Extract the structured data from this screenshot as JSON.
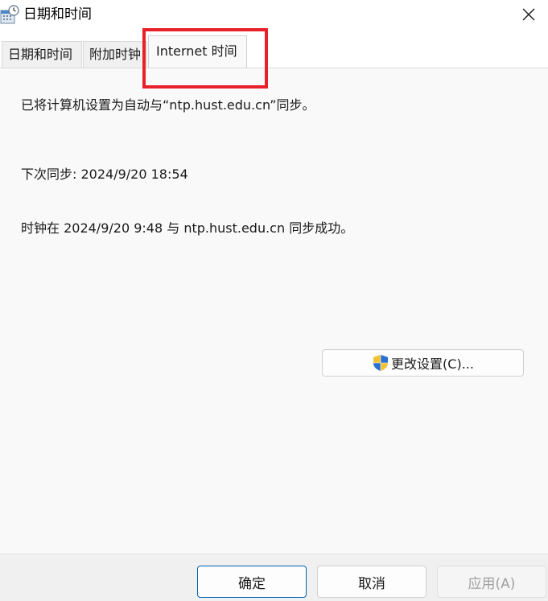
{
  "window": {
    "title": "日期和时间",
    "icon": "calendar-clock-icon",
    "close_icon": "close-icon"
  },
  "tabs": [
    {
      "label": "日期和时间",
      "selected": false
    },
    {
      "label": "附加时钟",
      "selected": false
    },
    {
      "label": "Internet 时间",
      "selected": true
    }
  ],
  "annotation": {
    "color": "#e8202a",
    "target": "Internet 时间"
  },
  "content": {
    "sync_status": "已将计算机设置为自动与“ntp.hust.edu.cn”同步。",
    "next_sync": "下次同步: 2024/9/20 18:54",
    "last_sync": "时钟在 2024/9/20 9:48 与 ntp.hust.edu.cn 同步成功。"
  },
  "buttons": {
    "change_settings": "更改设置(C)...",
    "change_settings_icon": "uac-shield-icon",
    "ok": "确定",
    "cancel": "取消",
    "apply": "应用(A)"
  },
  "colors": {
    "accent": "#0063b1",
    "annotation": "#e8202a"
  }
}
